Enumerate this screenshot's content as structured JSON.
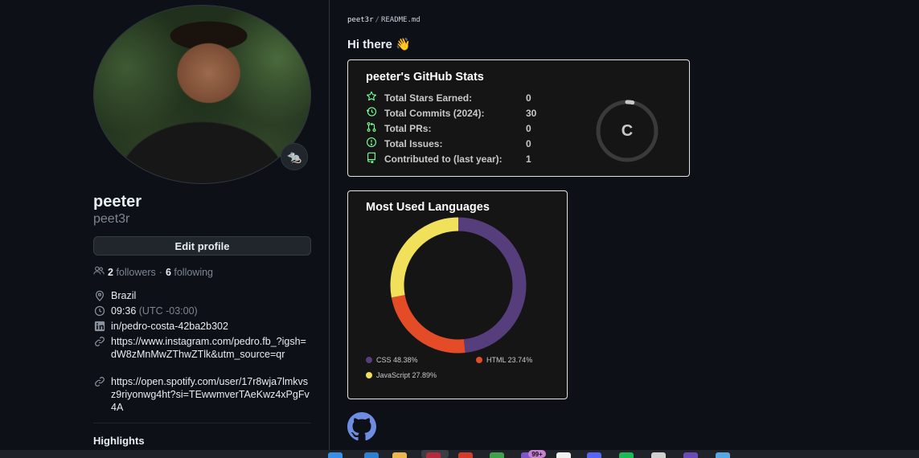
{
  "profile": {
    "name": "peeter",
    "login": "peet3r",
    "status_emoji": "🐀",
    "edit_button": "Edit profile",
    "followers_count": "2",
    "followers_label": "followers",
    "following_count": "6",
    "following_label": "following",
    "separator": "·",
    "location": "Brazil",
    "local_time": "09:36",
    "timezone": "(UTC -03:00)",
    "linkedin": "in/pedro-costa-42ba2b302",
    "instagram_link": "https://www.instagram.com/pedro.fb_?igsh=dW8zMnMwZThwZTlk&utm_source=qr",
    "spotify_link": "https://open.spotify.com/user/17r8wja7lmkvsz9riyonwg4ht?si=TEwwmverTAeKwz4xPgFv4A",
    "highlights_heading": "Highlights"
  },
  "readme": {
    "owner": "peet3r",
    "separator": "/",
    "filename": "README.md",
    "greeting": "Hi there 👋"
  },
  "stats_card": {
    "title": "peeter's GitHub Stats",
    "rank": "C",
    "rank_progress": 0.03,
    "accent_color": "#79ff97",
    "rows": [
      {
        "icon": "star-icon",
        "label": "Total Stars Earned:",
        "value": "0"
      },
      {
        "icon": "history-icon",
        "label": "Total Commits (2024):",
        "value": "30"
      },
      {
        "icon": "pull-request-icon",
        "label": "Total PRs:",
        "value": "0"
      },
      {
        "icon": "issue-icon",
        "label": "Total Issues:",
        "value": "0"
      },
      {
        "icon": "repo-icon",
        "label": "Contributed to (last year):",
        "value": "1"
      }
    ]
  },
  "languages_card": {
    "title": "Most Used Languages",
    "languages": [
      {
        "name": "CSS",
        "percent": 48.38,
        "label": "CSS 48.38%",
        "color": "#563d7c"
      },
      {
        "name": "HTML",
        "percent": 23.74,
        "label": "HTML 23.74%",
        "color": "#e34c26"
      },
      {
        "name": "JavaScript",
        "percent": 27.89,
        "label": "JavaScript 27.89%",
        "color": "#f1e05a"
      }
    ]
  },
  "taskbar": {
    "notification_badge": "99+"
  }
}
